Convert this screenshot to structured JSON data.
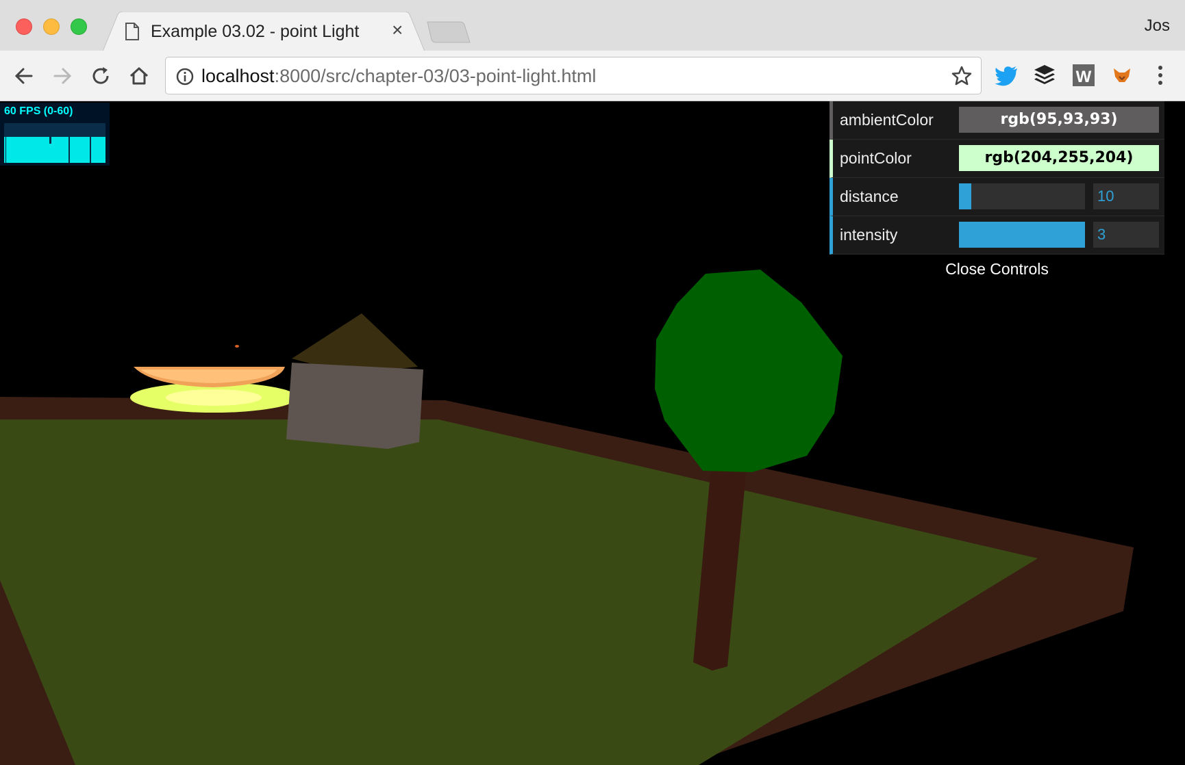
{
  "browser": {
    "tab_title": "Example 03.02 - point Light",
    "profile_name": "Jos",
    "url_host": "localhost",
    "url_rest": ":8000/src/chapter-03/03-point-light.html"
  },
  "stats": {
    "label": "60 FPS (0-60)"
  },
  "controls": {
    "ambient_label": "ambientColor",
    "ambient_value": "rgb(95,93,93)",
    "ambient_color": "#5f5d5d",
    "point_label": "pointColor",
    "point_value": "rgb(204,255,204)",
    "point_color": "#ccffcc",
    "distance_label": "distance",
    "distance_value": "10",
    "distance_fraction": 0.1,
    "intensity_label": "intensity",
    "intensity_value": "3",
    "intensity_fraction": 1.0,
    "close_label": "Close Controls"
  },
  "colors": {
    "slider_accent": "#2fa1d6",
    "ground": "#3a4a14",
    "border": "#3a1e14",
    "tree_foliage": "#005f00",
    "tree_trunk": "#3a1a10",
    "cube": "#5f5550"
  }
}
